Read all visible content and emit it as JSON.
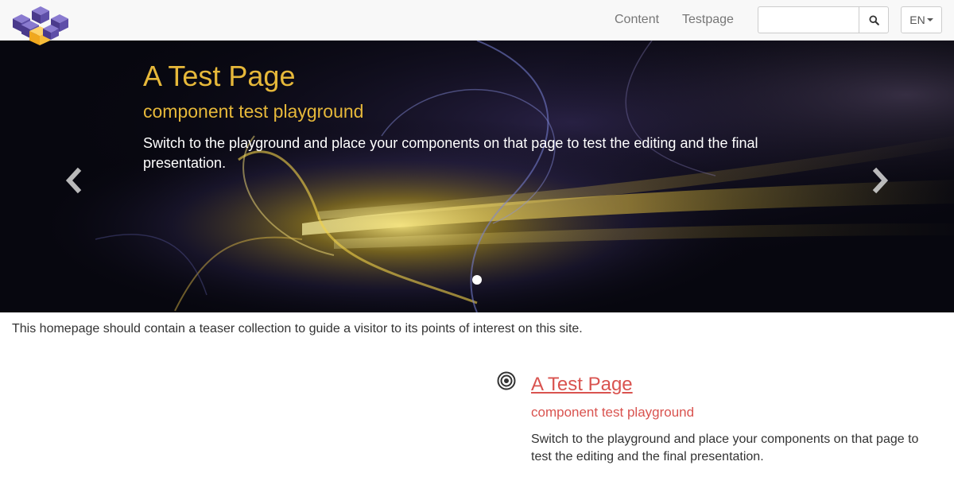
{
  "navbar": {
    "links": [
      "Content",
      "Testpage"
    ],
    "search": {
      "value": "",
      "placeholder": ""
    },
    "search_icon": "search-icon",
    "language": "EN",
    "language_icon": "caret-down-icon",
    "logo_icon": "cubes-logo-icon"
  },
  "hero": {
    "title": "A Test Page",
    "subtitle": "component test playground",
    "text": "Switch to the playground and place your components on that page to test the editing and the final presentation.",
    "prev_icon": "chevron-left-icon",
    "next_icon": "chevron-right-icon",
    "active_slide": 1,
    "slide_count": 1
  },
  "intro": {
    "text": "This homepage should contain a teaser collection to guide a visitor to its points of interest on this site."
  },
  "teaser": {
    "icon": "target-icon",
    "title": "A Test Page",
    "subtitle": "component test playground",
    "text": "Switch to the playground and place your components on that page to test the editing and the final presentation."
  },
  "colors": {
    "accent_gold": "#e6b83a",
    "accent_red": "#d9534f",
    "navbar_bg": "#f8f8f8",
    "logo_purple": "#5b4a9e",
    "logo_yellow": "#f5b82e"
  }
}
